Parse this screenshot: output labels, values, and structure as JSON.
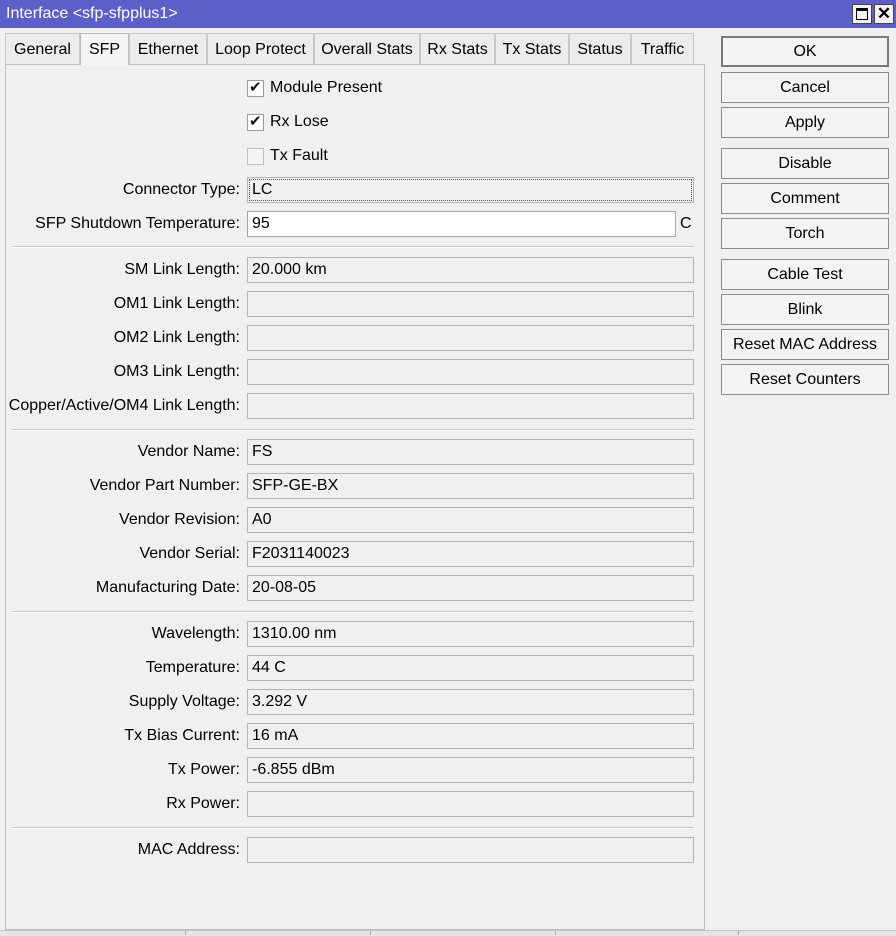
{
  "window": {
    "title": "Interface <sfp-sfpplus1>"
  },
  "tabs": [
    {
      "label": "General"
    },
    {
      "label": "SFP"
    },
    {
      "label": "Ethernet"
    },
    {
      "label": "Loop Protect"
    },
    {
      "label": "Overall Stats"
    },
    {
      "label": "Rx Stats"
    },
    {
      "label": "Tx Stats"
    },
    {
      "label": "Status"
    },
    {
      "label": "Traffic"
    }
  ],
  "active_tab": "SFP",
  "checkboxes": {
    "module_present": {
      "label": "Module Present",
      "checked": true
    },
    "rx_lose": {
      "label": "Rx Lose",
      "checked": true
    },
    "tx_fault": {
      "label": "Tx Fault",
      "checked": false
    }
  },
  "fields": {
    "connector_type": {
      "label": "Connector Type:",
      "value": "LC"
    },
    "sfp_shutdown_temperature": {
      "label": "SFP Shutdown Temperature:",
      "value": "95",
      "unit": "C"
    },
    "sm_link_length": {
      "label": "SM Link Length:",
      "value": "20.000 km"
    },
    "om1_link_length": {
      "label": "OM1 Link Length:",
      "value": ""
    },
    "om2_link_length": {
      "label": "OM2 Link Length:",
      "value": ""
    },
    "om3_link_length": {
      "label": "OM3 Link Length:",
      "value": ""
    },
    "copper_link_length": {
      "label": "Copper/Active/OM4 Link Length:",
      "value": ""
    },
    "vendor_name": {
      "label": "Vendor Name:",
      "value": "FS"
    },
    "vendor_part_number": {
      "label": "Vendor Part Number:",
      "value": "SFP-GE-BX"
    },
    "vendor_revision": {
      "label": "Vendor Revision:",
      "value": "A0"
    },
    "vendor_serial": {
      "label": "Vendor Serial:",
      "value": "F2031140023"
    },
    "manufacturing_date": {
      "label": "Manufacturing Date:",
      "value": "20-08-05"
    },
    "wavelength": {
      "label": "Wavelength:",
      "value": "1310.00 nm"
    },
    "temperature": {
      "label": "Temperature:",
      "value": "44 C"
    },
    "supply_voltage": {
      "label": "Supply Voltage:",
      "value": "3.292 V"
    },
    "tx_bias_current": {
      "label": "Tx Bias Current:",
      "value": "16 mA"
    },
    "tx_power": {
      "label": "Tx Power:",
      "value": "-6.855 dBm"
    },
    "rx_power": {
      "label": "Rx Power:",
      "value": ""
    },
    "mac_address": {
      "label": "MAC Address:",
      "value": ""
    }
  },
  "buttons": {
    "ok": "OK",
    "cancel": "Cancel",
    "apply": "Apply",
    "disable": "Disable",
    "comment": "Comment",
    "torch": "Torch",
    "cable_test": "Cable Test",
    "blink": "Blink",
    "reset_mac_address": "Reset MAC Address",
    "reset_counters": "Reset Counters"
  },
  "icons": {
    "maximize": "maximize-icon",
    "close": "close-icon",
    "checkmark": "checkmark-icon"
  },
  "colors": {
    "titlebar": "#5b5fc7",
    "background": "#f0f0f0"
  }
}
